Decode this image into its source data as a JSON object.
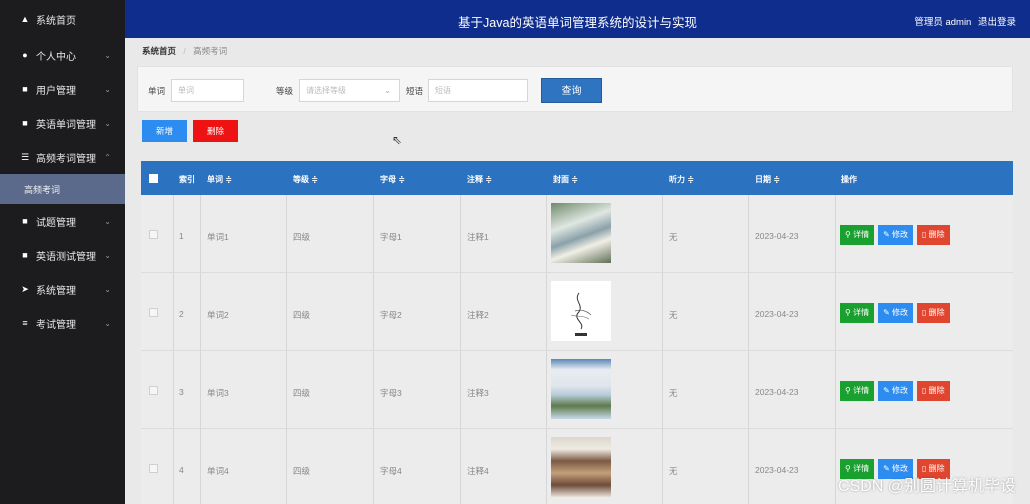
{
  "sidebar": {
    "home": "系统首页",
    "items": [
      {
        "label": "个人中心"
      },
      {
        "label": "用户管理"
      },
      {
        "label": "英语单词管理"
      },
      {
        "label": "高频考词管理"
      },
      {
        "label": "试题管理"
      },
      {
        "label": "英语测试管理"
      },
      {
        "label": "系统管理"
      },
      {
        "label": "考试管理"
      }
    ],
    "active_sub": "高频考词"
  },
  "header": {
    "title": "基于Java的英语单词管理系统的设计与实现",
    "user": "管理员 admin",
    "logout": "退出登录"
  },
  "breadcrumb": {
    "home": "系统首页",
    "current": "高频考词"
  },
  "search": {
    "word_label": "单词",
    "word_placeholder": "单词",
    "level_label": "等级",
    "level_placeholder": "请选择等级",
    "phrase_label": "短语",
    "phrase_placeholder": "短语",
    "query_button": "查询"
  },
  "actions": {
    "add": "新增",
    "delete": "删除"
  },
  "table": {
    "headers": {
      "index": "索引",
      "word": "单词 ≑",
      "level": "等级 ≑",
      "letter": "字母 ≑",
      "note": "注释 ≑",
      "cover": "封面 ≑",
      "listening": "听力 ≑",
      "date": "日期 ≑",
      "ops": "操作"
    },
    "rows": [
      {
        "index": "1",
        "word": "单词1",
        "level": "四级",
        "letter": "字母1",
        "note": "注释1",
        "listening": "无",
        "date": "2023-04-23"
      },
      {
        "index": "2",
        "word": "单词2",
        "level": "四级",
        "letter": "字母2",
        "note": "注释2",
        "listening": "无",
        "date": "2023-04-23"
      },
      {
        "index": "3",
        "word": "单词3",
        "level": "四级",
        "letter": "字母3",
        "note": "注释3",
        "listening": "无",
        "date": "2023-04-23"
      },
      {
        "index": "4",
        "word": "单词4",
        "level": "四级",
        "letter": "字母4",
        "note": "注释4",
        "listening": "无",
        "date": "2023-04-23"
      }
    ],
    "op_detail": "详情",
    "op_edit": "修改",
    "op_delete": "删除"
  },
  "watermark": "CSDN @别圆计算机毕设",
  "colors": {
    "header": "#0f2d8c",
    "sidebar": "#1c1c1f",
    "table_head": "#2b72c0",
    "query": "#2e74c0",
    "delete": "#ef1212",
    "detail": "#19a02e"
  }
}
